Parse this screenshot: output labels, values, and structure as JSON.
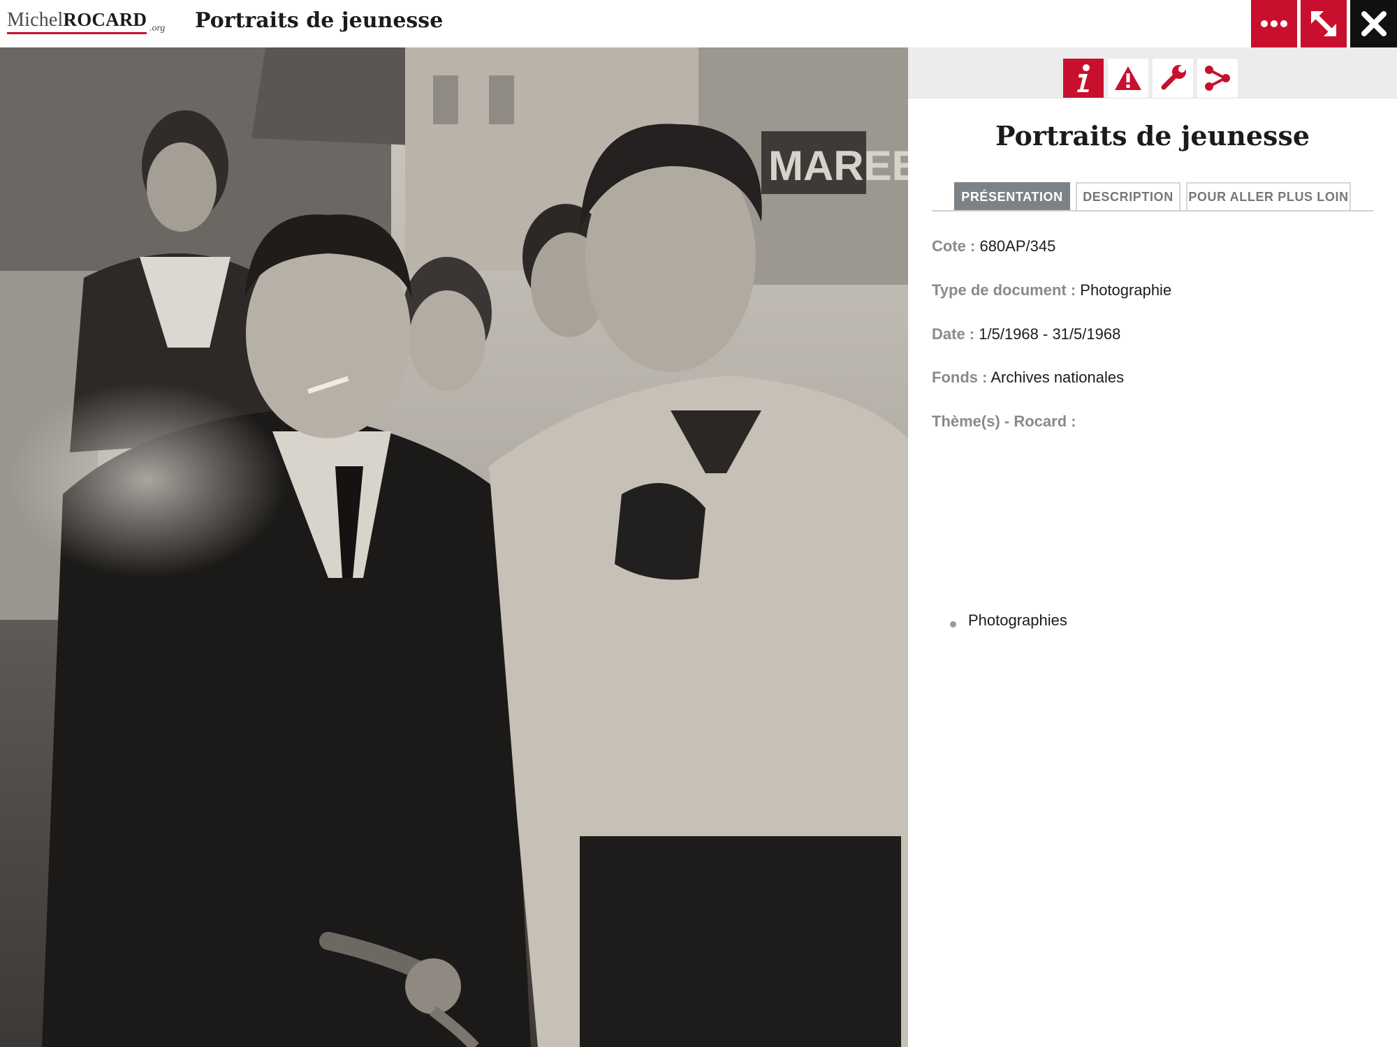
{
  "header": {
    "logo_first": "Michel",
    "logo_last": "ROCARD",
    "logo_tld": ".org",
    "title": "Portraits de jeunesse",
    "buttons": [
      {
        "name": "more",
        "icon": "ellipsis-icon"
      },
      {
        "name": "expand",
        "icon": "expand-arrow-icon"
      },
      {
        "name": "close",
        "icon": "close-icon"
      }
    ]
  },
  "colors": {
    "accent": "#c8102e",
    "close_bg": "#111111",
    "tab_active_bg": "#7d8286",
    "label_grey": "#8a8a8a"
  },
  "photo": {
    "kind": "black-and-white street photograph",
    "sign_text": "MAREE"
  },
  "panel": {
    "tools": [
      {
        "icon": "info-icon",
        "active": true
      },
      {
        "icon": "warning-icon",
        "active": false
      },
      {
        "icon": "wrench-icon",
        "active": false
      },
      {
        "icon": "share-icon",
        "active": false
      }
    ],
    "title": "Portraits de jeunesse",
    "tabs": [
      "PRÉSENTATION",
      "DESCRIPTION",
      "POUR ALLER PLUS LOIN"
    ],
    "active_tab": "PRÉSENTATION",
    "meta": {
      "cote_label": "Cote :",
      "cote_value": "680AP/345",
      "type_label": "Type de document :",
      "type_value": "Photographie",
      "date_label": "Date :",
      "date_value": "1/5/1968 - 31/5/1968",
      "fonds_label": "Fonds :",
      "fonds_value": "Archives nationales",
      "theme_label": "Thème(s) - Rocard :",
      "themes": [
        "Photographies"
      ]
    }
  }
}
